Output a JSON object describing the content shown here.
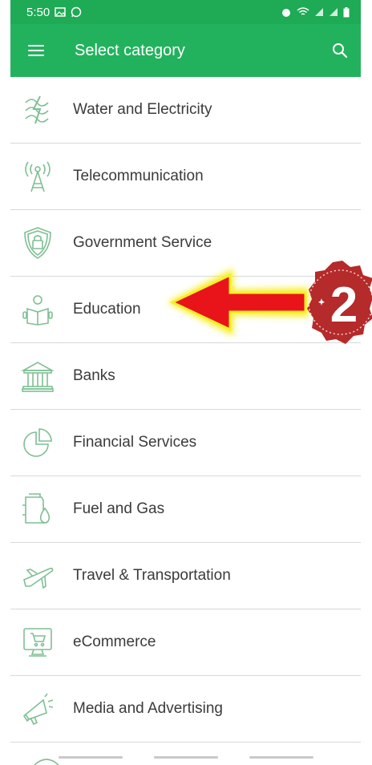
{
  "status": {
    "time": "5:50",
    "left_icons": [
      "image-icon",
      "whatsapp-icon"
    ],
    "right_icons": [
      "alarm-icon",
      "wifi-icon",
      "signal-icon",
      "signal-icon",
      "battery-icon"
    ]
  },
  "appbar": {
    "title": "Select category"
  },
  "categories": [
    {
      "label": "Water and Electricity",
      "icon": "water-electricity-icon"
    },
    {
      "label": "Telecommunication",
      "icon": "antenna-icon"
    },
    {
      "label": "Government Service",
      "icon": "shield-lock-icon"
    },
    {
      "label": "Education",
      "icon": "reading-person-icon"
    },
    {
      "label": "Banks",
      "icon": "bank-icon"
    },
    {
      "label": "Financial Services",
      "icon": "pie-chart-icon"
    },
    {
      "label": "Fuel and Gas",
      "icon": "fuel-drop-icon"
    },
    {
      "label": "Travel & Transportation",
      "icon": "airplane-icon"
    },
    {
      "label": "eCommerce",
      "icon": "shopping-screen-icon"
    },
    {
      "label": "Media and Advertising",
      "icon": "megaphone-icon"
    }
  ],
  "annotation": {
    "badge_number": "2"
  },
  "colors": {
    "statusbar": "#1faa55",
    "appbar": "#22b25d",
    "icon_stroke": "#7fbf93",
    "arrow": "#e8141a",
    "arrow_glow": "#f6ef2a",
    "badge": "#b52a2a"
  }
}
